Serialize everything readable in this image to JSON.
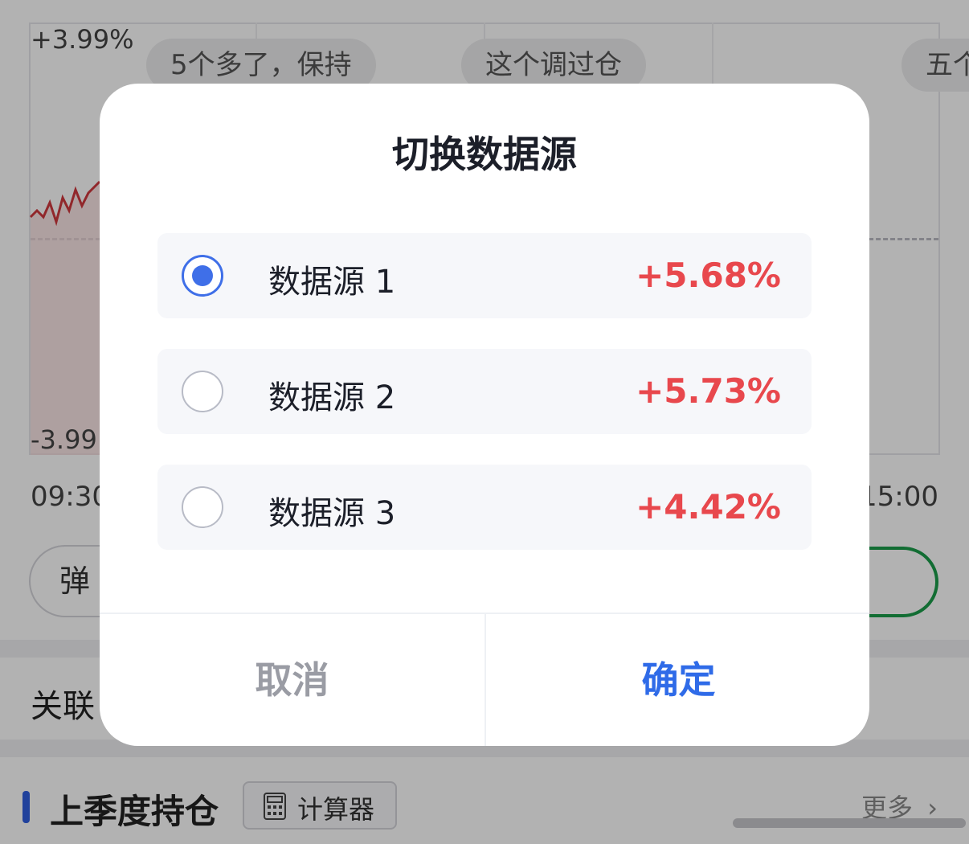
{
  "background": {
    "chart": {
      "y_max_label": "+3.99%",
      "y_min_label": "-3.99",
      "x_start_label": "09:30",
      "x_end_label": "15:00"
    },
    "bubbles": [
      "5个多了，保持",
      "这个调过仓",
      "五个"
    ],
    "danmu_label": "弹",
    "related_label": "关联",
    "last_quarter_label": "上季度持仓",
    "calculator_label": "计算器",
    "more_label": "更多"
  },
  "dialog": {
    "title": "切换数据源",
    "options": [
      {
        "label": "数据源 1",
        "change": "+5.68%",
        "selected": true
      },
      {
        "label": "数据源 2",
        "change": "+5.73%",
        "selected": false
      },
      {
        "label": "数据源 3",
        "change": "+4.42%",
        "selected": false
      }
    ],
    "cancel_label": "取消",
    "confirm_label": "确定"
  },
  "colors": {
    "accent_blue": "#3f6fe8",
    "rise_red": "#e8484d",
    "pill_green": "#1a9d4a"
  }
}
